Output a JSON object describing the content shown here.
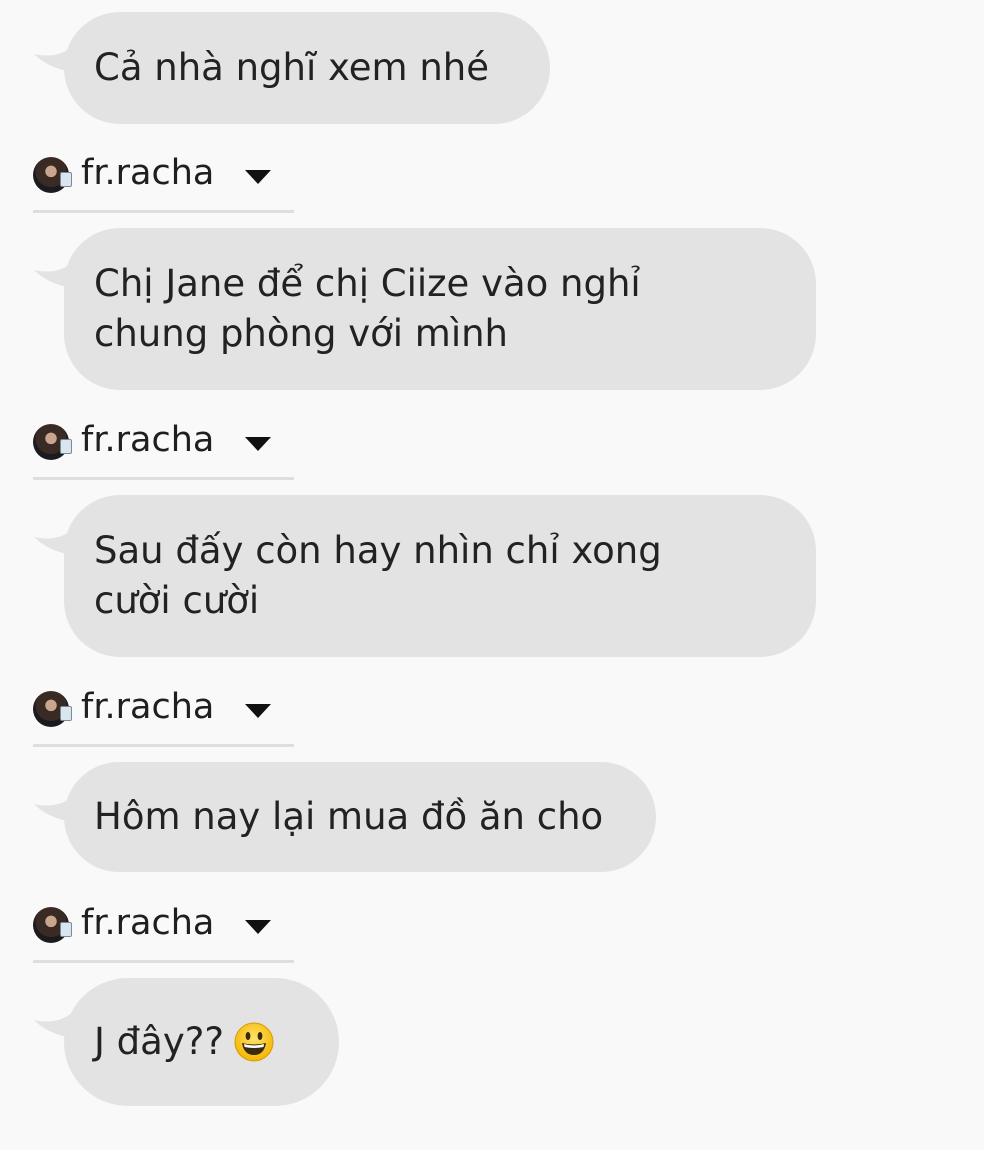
{
  "messages": [
    {
      "text": "Cả nhà nghĩ xem nhé"
    },
    {
      "text": "Chị Jane để chị Ciize vào nghỉ\nchung phòng với mình"
    },
    {
      "text": "Sau đấy còn hay nhìn chỉ xong\ncười cười"
    },
    {
      "text": "Hôm nay lại mua đồ ăn cho"
    },
    {
      "text": "J đây??",
      "emoji": "grinning-face-emoji"
    }
  ],
  "senders": [
    {
      "name": "fr.racha",
      "avatar_icon": "user-avatar-icon",
      "dropdown_icon": "caret-down-icon"
    },
    {
      "name": "fr.racha",
      "avatar_icon": "user-avatar-icon",
      "dropdown_icon": "caret-down-icon"
    },
    {
      "name": "fr.racha",
      "avatar_icon": "user-avatar-icon",
      "dropdown_icon": "caret-down-icon"
    },
    {
      "name": "fr.racha",
      "avatar_icon": "user-avatar-icon",
      "dropdown_icon": "caret-down-icon"
    }
  ],
  "colors": {
    "background": "#f9f9f9",
    "bubble": "#e3e3e3",
    "text": "#222222",
    "divider": "#dedede"
  }
}
